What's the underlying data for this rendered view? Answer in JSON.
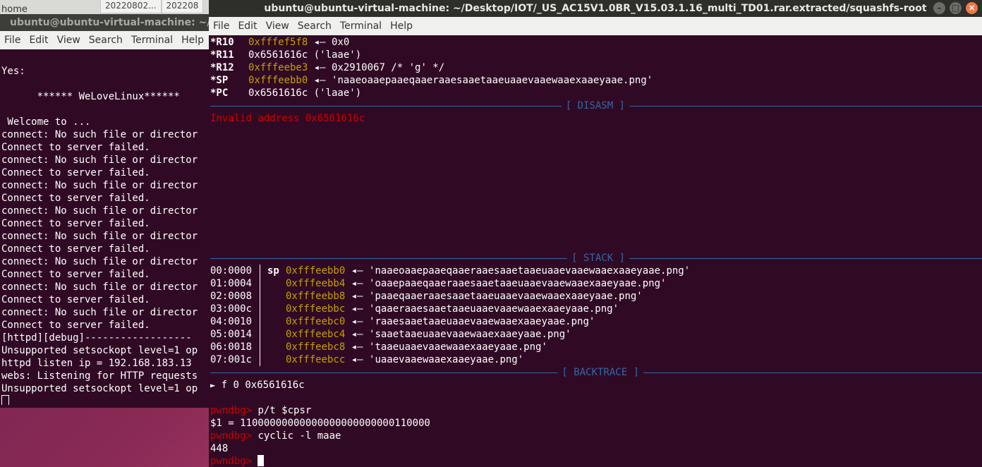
{
  "desktop": {
    "label": "home",
    "tabs": [
      "20220802...",
      "202208"
    ]
  },
  "left_terminal": {
    "title": "ubuntu@ubuntu-virtual-machine: ~/Des",
    "menu": [
      "File",
      "Edit",
      "View",
      "Search",
      "Terminal",
      "Help"
    ],
    "lines": [
      "",
      "Yes:",
      "",
      "      ****** WeLoveLinux******",
      "",
      " Welcome to ...",
      "connect: No such file or director",
      "Connect to server failed.",
      "connect: No such file or director",
      "Connect to server failed.",
      "connect: No such file or director",
      "Connect to server failed.",
      "connect: No such file or director",
      "Connect to server failed.",
      "connect: No such file or director",
      "Connect to server failed.",
      "connect: No such file or director",
      "Connect to server failed.",
      "connect: No such file or director",
      "Connect to server failed.",
      "connect: No such file or director",
      "Connect to server failed.",
      "[httpd][debug]------------------",
      "Unsupported setsockopt level=1 op",
      "httpd listen ip = 192.168.183.13",
      "webs: Listening for HTTP requests",
      "Unsupported setsockopt level=1 op"
    ]
  },
  "right_terminal": {
    "title": "ubuntu@ubuntu-virtual-machine: ~/Desktop/IOT/_US_AC15V1.0BR_V15.03.1.16_multi_TD01.rar.extracted/squashfs-root",
    "menu": [
      "File",
      "Edit",
      "View",
      "Search",
      "Terminal",
      "Help"
    ],
    "registers": [
      {
        "name": "*R10",
        "addr": "0xfffef5f8",
        "rest": " ◂— 0x0"
      },
      {
        "name": "*R11",
        "addr": "",
        "rest": "0x6561616c ('laae')"
      },
      {
        "name": "*R12",
        "addr": "0xfffeebe3",
        "rest": " ◂— 0x2910067 /* 'g' */"
      },
      {
        "name": "*SP",
        "addr": "0xfffeebb0",
        "rest": " ◂— 'naaeoaaepaaeqaaeraaesaaetaaeuaaevaaewaaexaaeyaae.png'"
      },
      {
        "name": "*PC",
        "addr": "",
        "rest": "0x6561616c ('laae')"
      }
    ],
    "disasm_label": "[ DISASM ]",
    "disasm_error": "Invalid address 0x6561616c",
    "stack_label": "[ STACK ]",
    "stack": [
      {
        "off": "00:0000",
        "sp": "sp",
        "addr": "0xfffeebb0",
        "val": " ◂— 'naaeoaaepaaeqaaeraaesaaetaaeuaaevaaewaaexaaeyaae.png'"
      },
      {
        "off": "01:0004",
        "sp": "",
        "addr": "0xfffeebb4",
        "val": " ◂— 'oaaepaaeqaaeraaesaaetaaeuaaevaaewaaexaaeyaae.png'"
      },
      {
        "off": "02:0008",
        "sp": "",
        "addr": "0xfffeebb8",
        "val": " ◂— 'paaeqaaeraaesaaetaaeuaaevaaewaaexaaeyaae.png'"
      },
      {
        "off": "03:000c",
        "sp": "",
        "addr": "0xfffeebbc",
        "val": " ◂— 'qaaeraaesaaetaaeuaaevaaewaaexaaeyaae.png'"
      },
      {
        "off": "04:0010",
        "sp": "",
        "addr": "0xfffeebc0",
        "val": " ◂— 'raaesaaetaaeuaaevaaewaaexaaeyaae.png'"
      },
      {
        "off": "05:0014",
        "sp": "",
        "addr": "0xfffeebc4",
        "val": " ◂— 'saaetaaeuaaevaaewaaexaaeyaae.png'"
      },
      {
        "off": "06:0018",
        "sp": "",
        "addr": "0xfffeebc8",
        "val": " ◂— 'taaeuaaevaaewaaexaaeyaae.png'"
      },
      {
        "off": "07:001c",
        "sp": "",
        "addr": "0xfffeebcc",
        "val": " ◂— 'uaaevaaewaaexaaeyaae.png'"
      }
    ],
    "backtrace_label": "[ BACKTRACE ]",
    "backtrace": " f 0 0x6561616c",
    "session": [
      {
        "prompt": "pwndbg> ",
        "text": "p/t $cpsr"
      },
      {
        "prompt": "",
        "text": "$1 = 11000000000000000000000000110000"
      },
      {
        "prompt": "pwndbg> ",
        "text": "cyclic -l maae"
      },
      {
        "prompt": "",
        "text": "448"
      }
    ],
    "final_prompt": "pwndbg> "
  }
}
